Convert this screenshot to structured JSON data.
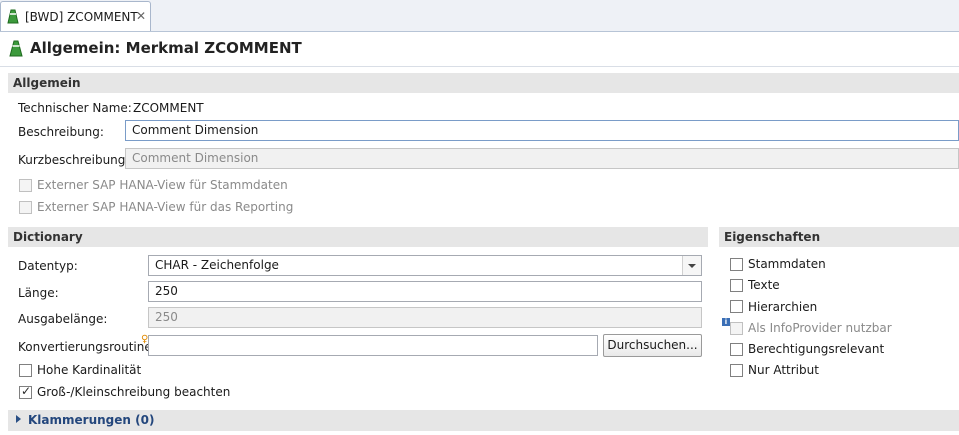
{
  "tab": {
    "label": "[BWD] ZCOMMENT"
  },
  "header": {
    "title": "Allgemein: Merkmal ZCOMMENT"
  },
  "allgemein": {
    "section_title": "Allgemein",
    "technical_name_label": "Technischer Name:",
    "technical_name_value": "ZCOMMENT",
    "description_label": "Beschreibung:",
    "description_value": "Comment Dimension",
    "short_description_label": "Kurzbeschreibung:",
    "short_description_value": "Comment Dimension",
    "hana_master_label": "Externer SAP HANA-View für Stammdaten",
    "hana_reporting_label": "Externer SAP HANA-View für das Reporting"
  },
  "dictionary": {
    "section_title": "Dictionary",
    "datatype_label": "Datentyp:",
    "datatype_value": "CHAR - Zeichenfolge",
    "length_label": "Länge:",
    "length_value": "250",
    "output_length_label": "Ausgabelänge:",
    "output_length_value": "250",
    "conversion_label": "Konvertierungsroutine:",
    "conversion_value": "",
    "browse_label": "Durchsuchen...",
    "high_cardinality_label": "Hohe Kardinalität",
    "case_sensitive_label": "Groß-/Kleinschreibung beachten"
  },
  "properties": {
    "section_title": "Eigenschaften",
    "master_data": "Stammdaten",
    "texts": "Texte",
    "hierarchies": "Hierarchien",
    "infoprovider": "Als InfoProvider nutzbar",
    "authorization": "Berechtigungsrelevant",
    "attribute_only": "Nur Attribut"
  },
  "brackets": {
    "label": "Klammerungen (0)"
  }
}
